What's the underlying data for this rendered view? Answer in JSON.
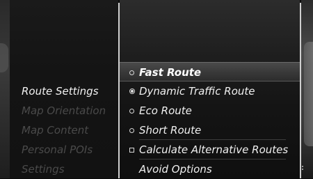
{
  "left_menu": {
    "items": [
      {
        "label": "Route Settings",
        "active": true
      },
      {
        "label": "Map Orientation",
        "active": false
      },
      {
        "label": "Map Content",
        "active": false
      },
      {
        "label": "Personal POIs",
        "active": false
      },
      {
        "label": "Settings",
        "active": false
      }
    ]
  },
  "route_options": {
    "items": [
      {
        "label": "Fast Route",
        "indicator": "radio-empty-icon",
        "selected": true
      },
      {
        "label": "Dynamic Traffic Route",
        "indicator": "radio-filled-icon",
        "selected": false
      },
      {
        "label": "Eco Route",
        "indicator": "radio-empty-icon",
        "selected": false
      },
      {
        "label": "Short Route",
        "indicator": "radio-empty-icon",
        "selected": false
      },
      {
        "label": "Calculate Alternative Routes",
        "indicator": "checkbox-icon",
        "selected": false
      },
      {
        "label": "Avoid Options",
        "indicator": "none",
        "selected": false
      }
    ]
  },
  "colors": {
    "active_text": "#f2f2f2",
    "inactive_text": "#4a4a4a",
    "highlight": "#3e3e3e",
    "divider": "#cfcfcf"
  }
}
